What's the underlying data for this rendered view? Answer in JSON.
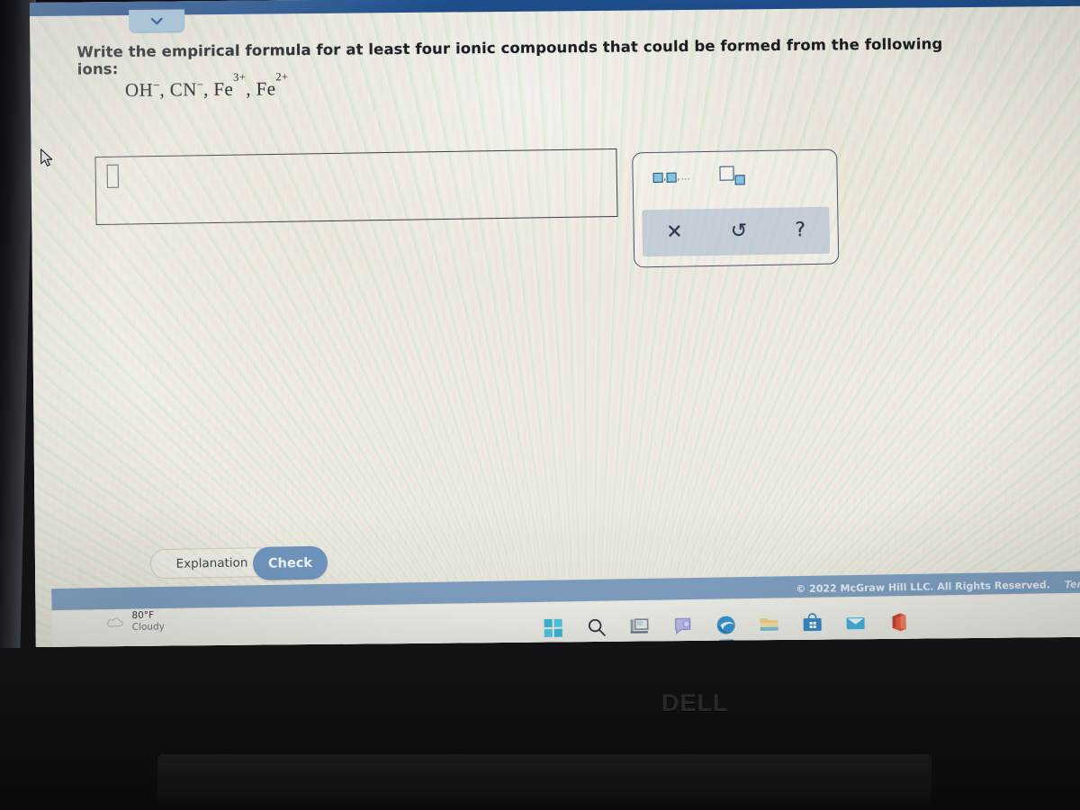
{
  "window": {
    "collapse_icon": "chevron-down-icon"
  },
  "question": {
    "prompt": "Write the empirical formula for at least four ionic compounds that could be formed from the following ions:",
    "ions": [
      {
        "symbol": "OH",
        "charge": "−"
      },
      {
        "symbol": "CN",
        "charge": "−"
      },
      {
        "symbol": "Fe",
        "charge": "3+"
      },
      {
        "symbol": "Fe",
        "charge": "2+"
      }
    ]
  },
  "answer": {
    "value": "",
    "placeholder": ""
  },
  "toolbar": {
    "buttons": [
      {
        "name": "list-of-formulas-button",
        "icon": "square-comma-square-ellipsis-icon"
      },
      {
        "name": "subscript-button",
        "icon": "square-subscript-square-icon"
      }
    ],
    "actions": [
      {
        "name": "clear-button",
        "label": "✕",
        "icon": "x-icon"
      },
      {
        "name": "undo-button",
        "label": "↺",
        "icon": "undo-icon"
      },
      {
        "name": "help-button",
        "label": "?",
        "icon": "question-mark-icon"
      }
    ]
  },
  "actions": {
    "explanation_label": "Explanation",
    "check_label": "Check"
  },
  "footer": {
    "copyright": "© 2022 McGraw Hill LLC. All Rights Reserved.",
    "terms": "Terms of"
  },
  "taskbar": {
    "weather": {
      "temperature": "80°F",
      "condition": "Cloudy",
      "icon": "cloud-icon"
    },
    "items": [
      {
        "name": "start-button",
        "icon": "windows-start-icon"
      },
      {
        "name": "search-button",
        "icon": "search-icon"
      },
      {
        "name": "task-view-button",
        "icon": "task-view-icon"
      },
      {
        "name": "chat-button",
        "icon": "chat-icon"
      },
      {
        "name": "edge-button",
        "icon": "edge-browser-icon",
        "active": true
      },
      {
        "name": "file-explorer-button",
        "icon": "folder-icon"
      },
      {
        "name": "microsoft-store-button",
        "icon": "store-icon"
      },
      {
        "name": "mail-button",
        "icon": "mail-icon"
      },
      {
        "name": "office-button",
        "icon": "office-icon"
      }
    ]
  },
  "device": {
    "brand": "DELL"
  },
  "colors": {
    "header_blue": "#1d4c88",
    "footer_blue": "#7b9cc0",
    "check_button": "#6e94bd",
    "icon_blue": "#2f4d7a",
    "icon_fill": "#7fc5dd"
  }
}
